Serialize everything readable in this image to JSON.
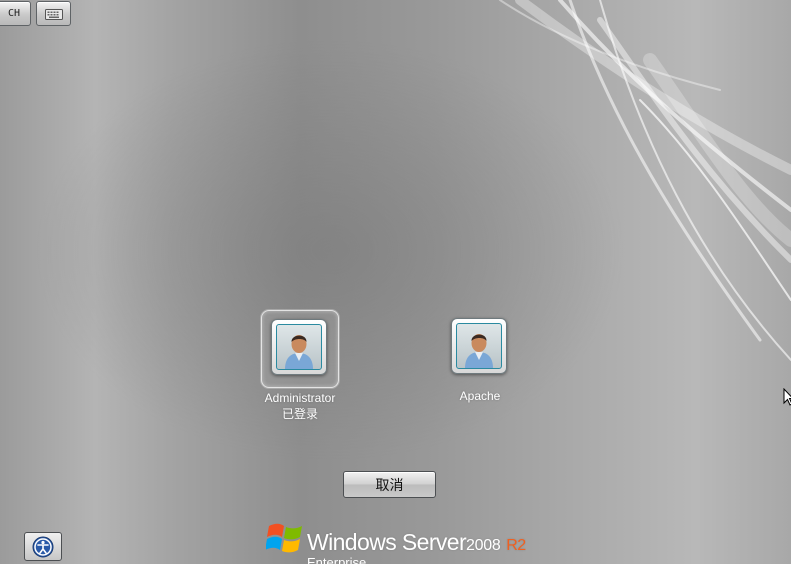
{
  "toolbar": {
    "language_label": "CH",
    "keyboard_icon": "keyboard-icon"
  },
  "users": [
    {
      "name": "Administrator",
      "status": "已登录",
      "icon": "user-avatar-icon",
      "selected": true
    },
    {
      "name": "Apache",
      "status": "",
      "icon": "user-avatar-icon",
      "selected": false
    }
  ],
  "actions": {
    "cancel_label": "取消"
  },
  "accessibility": {
    "icon": "ease-of-access-icon"
  },
  "branding": {
    "product": "Windows Server",
    "version": "2008",
    "release": "R2",
    "edition": "Enterprise",
    "r2_color": "#f06020"
  }
}
